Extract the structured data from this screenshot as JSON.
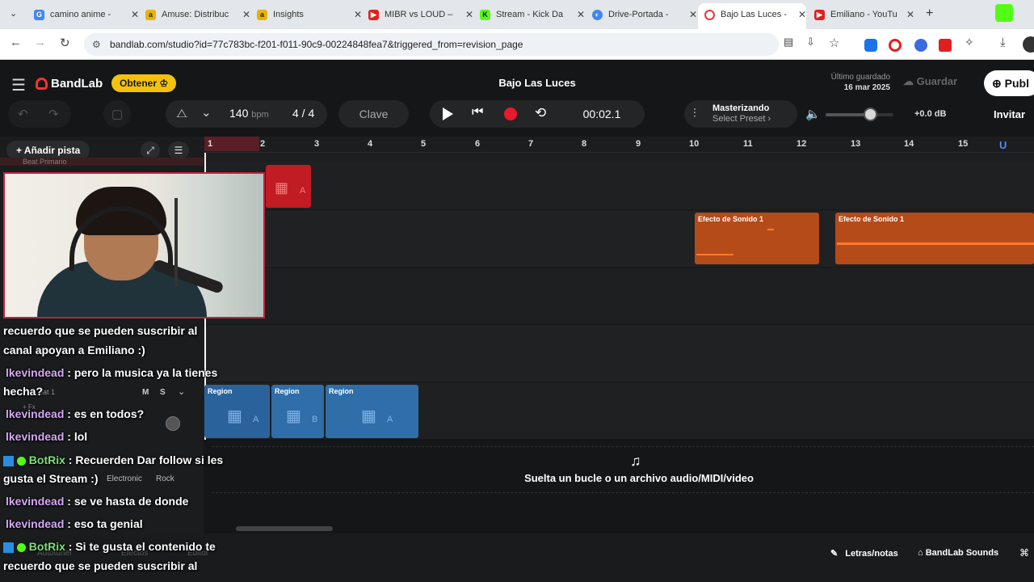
{
  "browser": {
    "tabs": [
      {
        "label": "camino anime -",
        "color": "#4285f4",
        "icon": "google-icon"
      },
      {
        "label": "Amuse: Distribuc",
        "color": "#e8b400",
        "icon": "amuse-icon"
      },
      {
        "label": "Insights",
        "color": "#e8b400",
        "icon": "amuse-icon"
      },
      {
        "label": "MIBR vs LOUD –",
        "color": "#e02020",
        "icon": "youtube-icon"
      },
      {
        "label": "Stream - Kick Da",
        "color": "#53fc18",
        "icon": "kick-icon"
      },
      {
        "label": "Drive-Portada -",
        "color": "#4285f4",
        "icon": "drive-icon"
      },
      {
        "label": "Bajo Las Luces -",
        "color": "#f03434",
        "icon": "bandlab-icon"
      },
      {
        "label": "Emiliano - YouTu",
        "color": "#e02020",
        "icon": "youtube-icon"
      }
    ],
    "url": "bandlab.com/studio?id=77c783bc-f201-f011-90c9-00224848fea7&triggered_from=revision_page"
  },
  "app": {
    "brand": "BandLab",
    "get_button": "Obtener",
    "project_title": "Bajo Las Luces",
    "last_saved_label": "Último guardado",
    "last_saved_date": "16 mar 2025",
    "save_button": "Guardar",
    "publish_button": "Publ",
    "invite_button": "Invitar",
    "tempo_value": "140",
    "tempo_unit": "bpm",
    "time_sig": "4 / 4",
    "key_button": "Clave",
    "time_display": "00:02.1",
    "mastering_label": "Masterizando",
    "mastering_preset": "Select Preset",
    "volume_db": "+0.0 dB",
    "add_track": "Añadir pista"
  },
  "ruler": {
    "bars": [
      "1",
      "2",
      "3",
      "4",
      "5",
      "6",
      "7",
      "8",
      "9",
      "10",
      "11",
      "12",
      "13",
      "14",
      "15"
    ]
  },
  "regions": {
    "sfx_label": "Efecto de Sonido 1",
    "region_label": "Region",
    "red_letter": "A",
    "blue_letters": [
      "A",
      "B",
      "A"
    ]
  },
  "dropzone": {
    "text": "Suelta un bucle o un archivo audio/MIDI/video"
  },
  "bottom": {
    "lyrics": "Letras/notas",
    "sounds": "BandLab Sounds"
  },
  "track_fragments": {
    "track_top": "Beat Primario",
    "track_name": "eat 1",
    "m": "M",
    "s": "S",
    "fx": "+ Fx",
    "tag_electronic": "Electronic",
    "tag_rock": "Rock",
    "autotuner": "Autotuner",
    "effects": "Efectos",
    "editor": "Editor"
  },
  "chat": [
    {
      "user": "",
      "text": "recuerdo que se pueden suscribir al"
    },
    {
      "user": "",
      "text": "canal apoyan a Emiliano :)"
    },
    {
      "user": "lkevindead",
      "text": ": pero la musica ya la tienes"
    },
    {
      "user": "",
      "text": "hecha?"
    },
    {
      "user": "lkevindead",
      "text": ": es en todos?"
    },
    {
      "user": "lkevindead",
      "text": ": lol"
    },
    {
      "user": "BotRix",
      "text": ": Recuerden Dar follow si les"
    },
    {
      "user": "",
      "text": "gusta el Stream :)"
    },
    {
      "user": "lkevindead",
      "text": ": se ve hasta de donde"
    },
    {
      "user": "lkevindead",
      "text": ": eso ta genial"
    },
    {
      "user": "BotRix",
      "text": ": Si te gusta el contenido te"
    },
    {
      "user": "",
      "text": "recuerdo que se pueden suscribir al"
    }
  ],
  "colors": {
    "accent": "#f03434",
    "record": "#e8192c",
    "sfx": "#c6531c",
    "blue": "#2f6ea8",
    "get": "#f4c20d"
  }
}
